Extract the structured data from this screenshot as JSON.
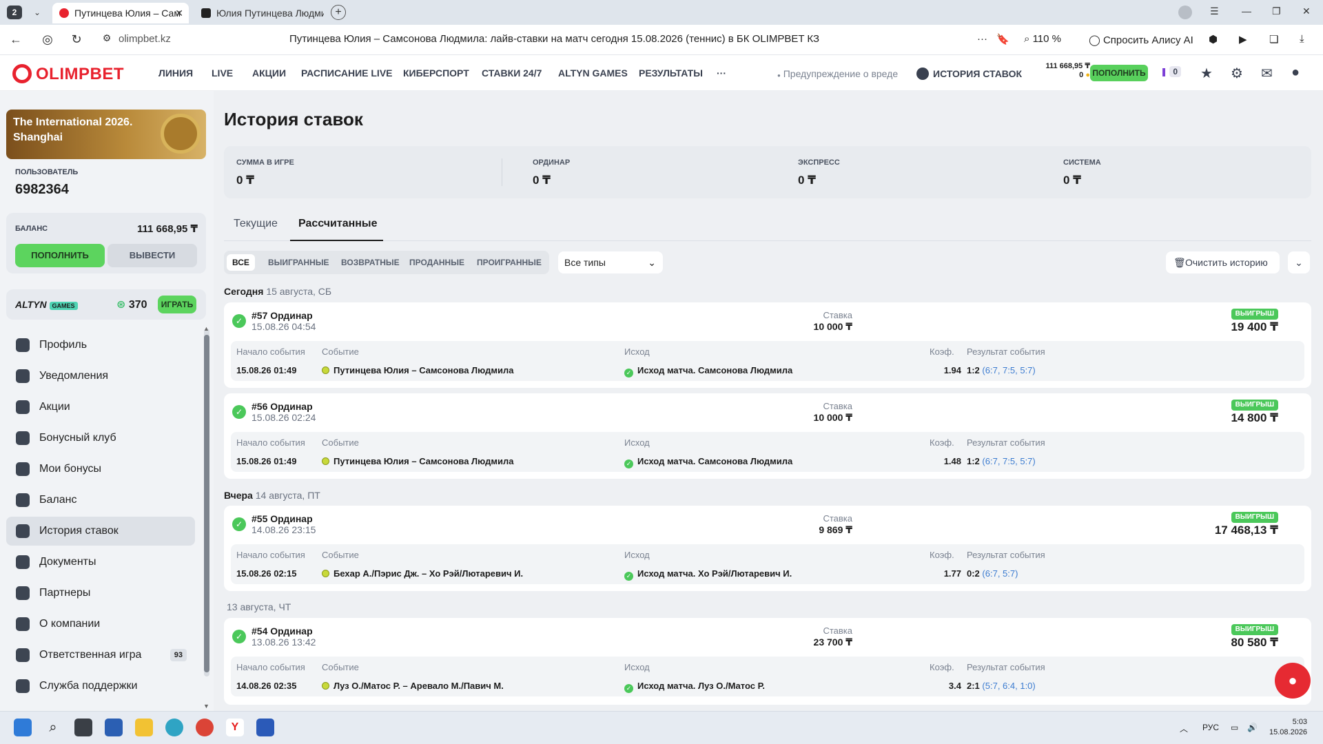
{
  "browser": {
    "tab_count": "2",
    "tabs": [
      {
        "label": "Путинцева Юлия – Сам"
      },
      {
        "label": "Юлия Путинцева Людми"
      }
    ],
    "url": "olimpbet.kz",
    "page_title": "Путинцева Юлия – Самсонова Людмила: лайв-ставки на матч сегодня 15.08.2026 (теннис) в БК OLIMPBET КЗ",
    "zoom": "110 %",
    "alice": "Спросить Алису AI"
  },
  "header": {
    "logo": "OLIMPBET",
    "nav": [
      "ЛИНИЯ",
      "LIVE",
      "АКЦИИ",
      "РАСПИСАНИЕ LIVE",
      "КИБЕРСПОРТ",
      "СТАВКИ 24/7",
      "ALTYN GAMES",
      "РЕЗУЛЬТАТЫ",
      "···"
    ],
    "warning": "Предупреждение о вреде",
    "history_link": "ИСТОРИЯ СТАВОК",
    "balance": "111 668,95 ₸",
    "bonus": "0",
    "topup": "ПОПОЛНИТЬ",
    "promo_count": "0"
  },
  "sidebar": {
    "banner": "The International 2026. Shanghai",
    "user_label": "ПОЛЬЗОВАТЕЛЬ",
    "user_id": "6982364",
    "balance_label": "БАЛАНС",
    "balance_value": "111 668,95 ₸",
    "topup": "ПОПОЛНИТЬ",
    "withdraw": "ВЫВЕСТИ",
    "altyn_logo": "ALTYN",
    "altyn_games": "GAMES",
    "altyn_count": "370",
    "play": "ИГРАТЬ",
    "menu": [
      {
        "label": "Профиль",
        "icon": "user-icon"
      },
      {
        "label": "Уведомления",
        "icon": "bell-icon"
      },
      {
        "label": "Акции",
        "icon": "gift-icon"
      },
      {
        "label": "Бонусный клуб",
        "icon": "club-icon"
      },
      {
        "label": "Мои бонусы",
        "icon": "star-icon"
      },
      {
        "label": "Баланс",
        "icon": "wallet-icon"
      },
      {
        "label": "История ставок",
        "icon": "clock-icon"
      },
      {
        "label": "Документы",
        "icon": "document-icon"
      },
      {
        "label": "Партнеры",
        "icon": "handshake-icon"
      },
      {
        "label": "О компании",
        "icon": "info-icon"
      },
      {
        "label": "Ответственная игра",
        "icon": "lock-icon",
        "badge": "93"
      },
      {
        "label": "Служба поддержки",
        "icon": "support-icon"
      }
    ]
  },
  "main": {
    "title": "История ставок",
    "summary": [
      {
        "label": "СУММА В ИГРЕ",
        "value": "0 ₸"
      },
      {
        "label": "ОРДИНАР",
        "value": "0 ₸"
      },
      {
        "label": "ЭКСПРЕСС",
        "value": "0 ₸"
      },
      {
        "label": "СИСТЕМА",
        "value": "0 ₸"
      }
    ],
    "tabs": [
      "Текущие",
      "Рассчитанные"
    ],
    "filters": [
      "ВСЕ",
      "ВЫИГРАННЫЕ",
      "ВОЗВРАТНЫЕ",
      "ПРОДАННЫЕ",
      "ПРОИГРАННЫЕ"
    ],
    "type_select": "Все типы",
    "clear_history": "Очистить историю",
    "col_headers": {
      "stake": "Ставка",
      "start": "Начало события",
      "event": "Событие",
      "outcome": "Исход",
      "coef": "Коэф.",
      "result": "Результат события"
    },
    "days": [
      {
        "label": "Сегодня",
        "date": "15 августа, СБ"
      },
      {
        "label": "Вчера",
        "date": "14 августа, ПТ"
      },
      {
        "label": "",
        "date": "13 августа, ЧТ"
      }
    ],
    "bets": [
      {
        "title": "#57 Ординар",
        "date": "15.08.26 04:54",
        "stake": "10 000 ₸",
        "badge": "ВЫИГРЫШ",
        "win": "19 400 ₸",
        "start": "15.08.26 01:49",
        "event": "Путинцева Юлия – Самсонова Людмила",
        "outcome": "Исход матча. Самсонова Людмила",
        "coef": "1.94",
        "score": "1:2",
        "sets": "(6:7, 7:5, 5:7)"
      },
      {
        "title": "#56 Ординар",
        "date": "15.08.26 02:24",
        "stake": "10 000 ₸",
        "badge": "ВЫИГРЫШ",
        "win": "14 800 ₸",
        "start": "15.08.26 01:49",
        "event": "Путинцева Юлия – Самсонова Людмила",
        "outcome": "Исход матча. Самсонова Людмила",
        "coef": "1.48",
        "score": "1:2",
        "sets": "(6:7, 7:5, 5:7)"
      },
      {
        "title": "#55 Ординар",
        "date": "14.08.26 23:15",
        "stake": "9 869 ₸",
        "badge": "ВЫИГРЫШ",
        "win": "17 468,13 ₸",
        "start": "15.08.26 02:15",
        "event": "Бехар А./Пэрис Дж. – Хо Рэй/Лютаревич И.",
        "outcome": "Исход матча. Хо Рэй/Лютаревич И.",
        "coef": "1.77",
        "score": "0:2",
        "sets": "(6:7, 5:7)"
      },
      {
        "title": "#54 Ординар",
        "date": "13.08.26 13:42",
        "stake": "23 700 ₸",
        "badge": "ВЫИГРЫШ",
        "win": "80 580 ₸",
        "start": "14.08.26 02:35",
        "event": "Луз О./Матос Р. – Аревало М./Павич М.",
        "outcome": "Исход матча. Луз О./Матос Р.",
        "coef": "3.4",
        "score": "2:1",
        "sets": "(5:7, 6:4, 1:0)"
      }
    ]
  },
  "taskbar": {
    "lang": "РУС",
    "time": "5:03",
    "date": "15.08.2026"
  }
}
